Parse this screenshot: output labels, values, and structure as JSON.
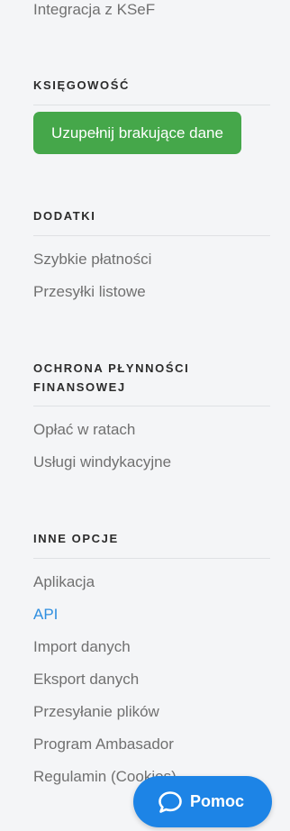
{
  "menu": {
    "top_item": "Integracja z KSeF",
    "ksiegowosc": {
      "heading": "KSIĘGOWOŚĆ",
      "button": "Uzupełnij brakujące dane"
    },
    "dodatki": {
      "heading": "DODATKI",
      "items": [
        "Szybkie płatności",
        "Przesyłki listowe"
      ]
    },
    "ochrona": {
      "heading_line1": "OCHRONA PŁYNNOŚCI",
      "heading_line2": "FINANSOWEJ",
      "items": [
        "Opłać w ratach",
        "Usługi windykacyjne"
      ]
    },
    "inne": {
      "heading": "INNE OPCJE",
      "items": [
        "Aplikacja",
        "API",
        "Import danych",
        "Eksport danych",
        "Przesyłanie plików",
        "Program Ambasador",
        "Regulamin (Cookies)"
      ],
      "active_item": "API"
    }
  },
  "help_button": {
    "label": "Pomoc",
    "icon": "chat-bubble-icon"
  },
  "colors": {
    "background": "#f4f5f7",
    "accent_link": "#2f8fe0",
    "cta_green": "#45a74a",
    "help_blue": "#1d84e6"
  }
}
